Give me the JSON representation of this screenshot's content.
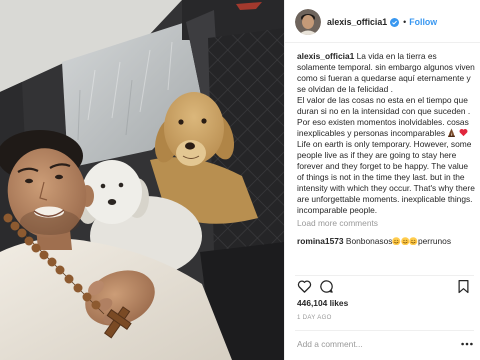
{
  "post": {
    "username": "alexis_officia1",
    "header": {
      "follow_separator": "•",
      "follow_label": "Follow"
    },
    "caption": {
      "paragraph_1": "La vida en la tierra es solamente temporal. sin embargo algunos viven como si fueran a quedarse aquí eternamente y se olvidan de la felicidad .",
      "paragraph_2": "El valor de las cosas no esta en el tiempo que duran si no en la intensidad con que suceden .",
      "paragraph_3_before_emoji": "Por eso existen momentos inolvidables. cosas inexplicables y personas incomparables",
      "emoji": [
        "folded-hands-dark-skin-tone",
        "red-heart"
      ],
      "paragraph_3_after_emoji": "Life on earth is only temporary. However, some people live as if they are going to stay here forever and they forget to be happy. The value of things is not in the time they last. but in the intensity with which they occur. That's why there are unforgettable moments. inexplicable things. incomparable people."
    },
    "load_more_label": "Load more comments",
    "comments": [
      {
        "username": "romina1573",
        "text_before": "Bonbonasos",
        "emoji": [
          "smiling-face-with-smiling-eyes",
          "smiling-face-with-smiling-eyes",
          "smiling-face-with-smiling-eyes"
        ],
        "text_after": "perrunos"
      }
    ],
    "likes": "446,104 likes",
    "timestamp": "1 DAY AGO",
    "add_comment_placeholder": "Add a comment..."
  },
  "icons": {
    "verified": "verified-badge-icon",
    "like": "heart-icon",
    "comment": "comment-icon",
    "save": "bookmark-icon",
    "more_options": "more-options-icon"
  },
  "colors": {
    "accent": "#3897f0",
    "text": "#262626",
    "muted": "#999999",
    "divider": "#efefef"
  }
}
